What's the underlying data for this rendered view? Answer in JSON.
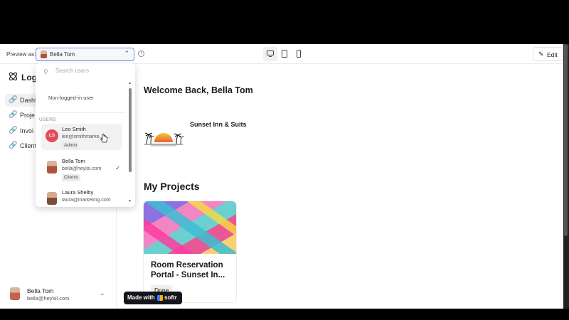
{
  "topbar": {
    "preview_label": "Preview as:",
    "selected_user": "Bella Tom",
    "edit_label": "Edit"
  },
  "sidebar": {
    "logo_text": "Log",
    "items": [
      {
        "label": "Dashb",
        "active": true
      },
      {
        "label": "Proje",
        "active": false
      },
      {
        "label": "Invoi",
        "active": false
      },
      {
        "label": "Client",
        "active": false
      }
    ],
    "current_user": {
      "name": "Bella Tom",
      "email": "bella@heylol.com"
    }
  },
  "dropdown": {
    "search_placeholder": "Search users",
    "guest_option": "Non-logged-in user",
    "section_label": "USERS",
    "users": [
      {
        "initials": "LS",
        "name": "Leo Smith",
        "email": "leo@smithmarke...c...",
        "badge": "Admin"
      },
      {
        "name": "Bella Tom",
        "email": "bella@heylol.com",
        "badge": "Clients",
        "selected": true
      },
      {
        "name": "Laura Shelby",
        "email": "laura@marketing.com"
      }
    ]
  },
  "main": {
    "welcome": "Welcome Back, Bella Tom",
    "company_name": "Sunset Inn & Suits",
    "section_title": "My Projects",
    "card": {
      "title": "Room Reservation Portal - Sunset In...",
      "status": "Done"
    }
  },
  "branding": {
    "made_with": "Made with",
    "brand": "softr"
  },
  "colors": {
    "focus_border": "#6e8fe6",
    "avatar_ls": "#e04a5a"
  }
}
